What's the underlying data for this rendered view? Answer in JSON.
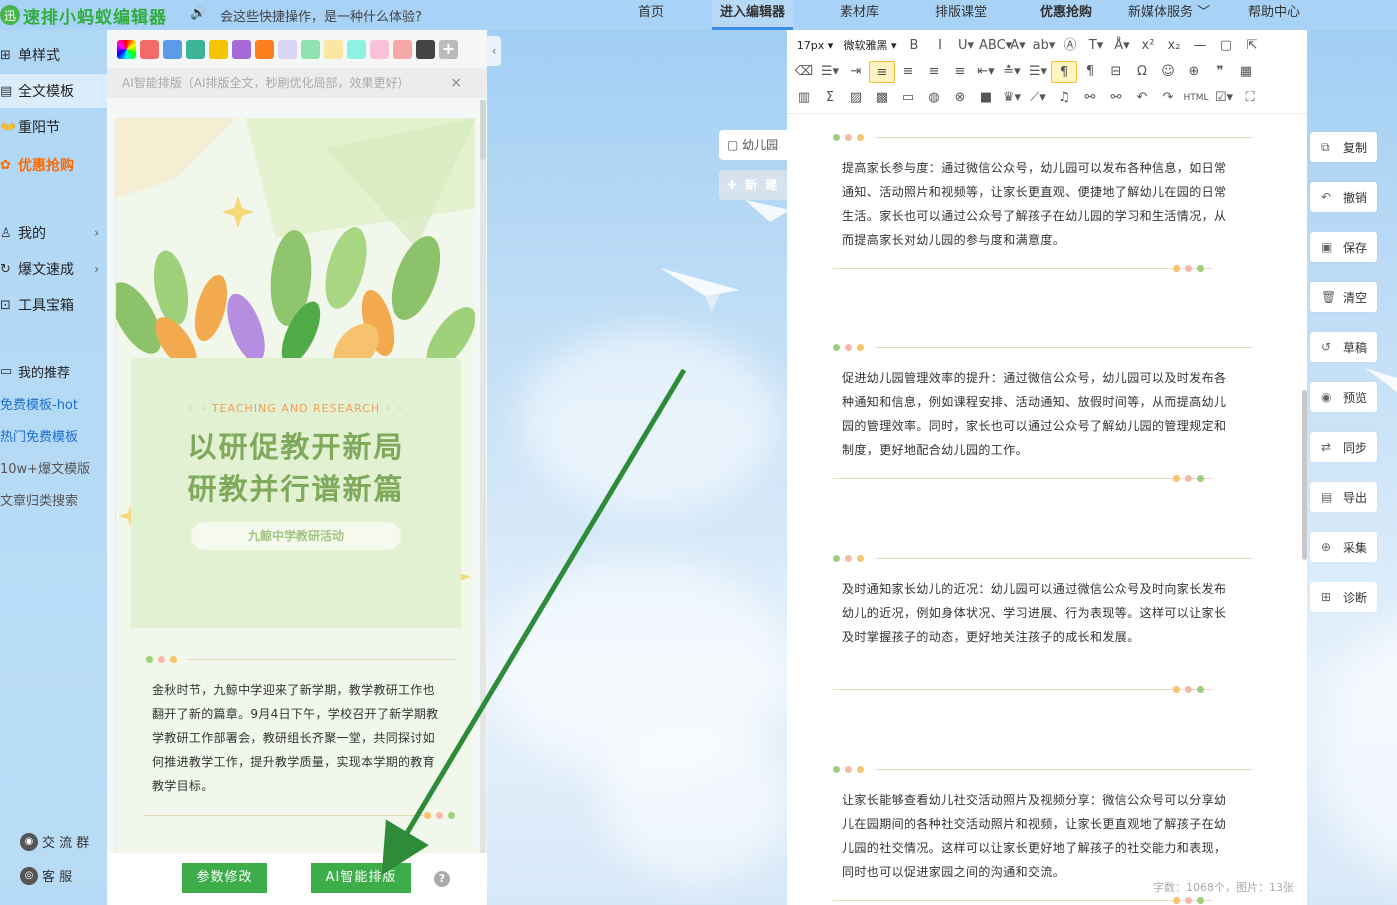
{
  "header": {
    "logo_mark": "迅",
    "logo": "速排小蚂蚁编辑器",
    "speaker_icon": "speaker-icon",
    "speaker_glyph": "🔊",
    "marquee": "会这些快捷操作，是一种什么体验?",
    "nav": [
      {
        "label": "首页"
      },
      {
        "label": "进入编辑器"
      },
      {
        "label": "素材库"
      },
      {
        "label": "排版课堂"
      },
      {
        "label": "优惠抢购"
      },
      {
        "label": "新媒体服务 ﹀"
      },
      {
        "label": "帮助中心"
      }
    ]
  },
  "sidebar": {
    "items": [
      {
        "label": "单样式",
        "icon": "grid-icon",
        "glyph": "⊞"
      },
      {
        "label": "全文模板",
        "icon": "document-icon",
        "glyph": "▤"
      },
      {
        "label": "重阳节",
        "icon": "hand-icon",
        "glyph": "👐"
      },
      {
        "label": "优惠抢购",
        "icon": "flame-icon",
        "glyph": "✿"
      }
    ],
    "menu": [
      {
        "label": "我的",
        "icon": "user-icon",
        "glyph": "♙",
        "chev": "›"
      },
      {
        "label": "爆文速成",
        "icon": "bolt-icon",
        "glyph": "↻",
        "chev": "›"
      },
      {
        "label": "工具宝箱",
        "icon": "toolbox-icon",
        "glyph": "⊡"
      }
    ],
    "recommend_title": "我的推荐",
    "recommend_icon_glyph": "▭",
    "links": [
      "免费模板-hot",
      "热门免费模板",
      "10w+爆文模版",
      "文章归类搜索"
    ],
    "footer": [
      {
        "label": "交 流 群",
        "icon": "chat-icon",
        "glyph": "◉"
      },
      {
        "label": "客  服",
        "icon": "headset-icon",
        "glyph": "◎"
      }
    ]
  },
  "panel": {
    "swatches": [
      "#f26b6b",
      "#5b9be8",
      "#3bb49a",
      "#f5c400",
      "#a56ad6",
      "#ff7f1e",
      "#d9d6f5",
      "#8fe3b0",
      "#fbe7a3",
      "#8ff0e3",
      "#f9c2d8",
      "#f6a7a7",
      "#444444"
    ],
    "plus_glyph": "+",
    "ai_hint": "AI智能排版（AI排版全文，秒刷优化局部，效果更好）",
    "close_glyph": "×",
    "collapse_glyph": "‹",
    "preview": {
      "tag": "TEACHING AND RESEARCH",
      "tag_deco": "◦ ◦",
      "title_line1": "以研促教开新局",
      "title_line2": "研教并行谱新篇",
      "subtitle": "九鲸中学教研活动",
      "body": "金秋时节，九鲸中学迎来了新学期，教学教研工作也翻开了新的篇章。9月4日下午，学校召开了新学期教学教研工作部署会，教研组长齐聚一堂，共同探讨如何推进教学工作，提升教学质量，实现本学期的教育教学目标。"
    },
    "buttons": {
      "params": "参数修改",
      "ai": "AI智能排版",
      "help": "?"
    }
  },
  "doc_tabs": {
    "current": "幼儿园",
    "current_icon_glyph": "▢",
    "new": "✚ 新 建"
  },
  "toolbar": {
    "font_size": "17px ▾",
    "font_family": "微软雅黑 ▾",
    "row1": [
      "B",
      "I",
      "U▾",
      "ABC▾",
      "A▾",
      "ab▾",
      "Ⓐ",
      "T▾",
      "Å▾",
      "x²",
      "x₂",
      "—",
      "▢",
      "⇱"
    ],
    "row2": [
      "⌫",
      "☰▾",
      "⇥",
      "≡",
      "≡",
      "≡",
      "≡",
      "⇤▾",
      "≛▾",
      "☰▾",
      "¶",
      "¶",
      "⊟",
      "Ω",
      "☺",
      "⊕",
      "❞",
      "▦"
    ],
    "row3": [
      "▥",
      "Σ",
      "▨",
      "▩",
      "▭",
      "◍",
      "⊗",
      "■",
      "♛▾",
      "⟋▾",
      "♫",
      "⚯",
      "⚯",
      "↶",
      "↷",
      "HTML",
      "☑▾",
      "⛶"
    ]
  },
  "content": {
    "blocks": [
      "提高家长参与度：通过微信公众号，幼儿园可以发布各种信息，如日常通知、活动照片和视频等，让家长更直观、便捷地了解幼儿在园的日常生活。家长也可以通过公众号了解孩子在幼儿园的学习和生活情况，从而提高家长对幼儿园的参与度和满意度。",
      "促进幼儿园管理效率的提升：通过微信公众号，幼儿园可以及时发布各种通知和信息，例如课程安排、活动通知、放假时间等，从而提高幼儿园的管理效率。同时，家长也可以通过公众号了解幼儿园的管理规定和制度，更好地配合幼儿园的工作。",
      "及时通知家长幼儿的近况：幼儿园可以通过微信公众号及时向家长发布幼儿的近况，例如身体状况、学习进展、行为表现等。这样可以让家长及时掌握孩子的动态，更好地关注孩子的成长和发展。",
      "让家长能够查看幼儿社交活动照片及视频分享：微信公众号可以分享幼儿在园期间的各种社交活动照片和视频，让家长更直观地了解孩子在幼儿园的社交情况。这样可以让家长更好地了解孩子的社交能力和表现，同时也可以促进家园之间的沟通和交流。"
    ],
    "counter": "字数：1068个，图片：13张"
  },
  "actions": [
    {
      "label": "复制",
      "icon": "copy-icon",
      "glyph": "⧉"
    },
    {
      "label": "撤销",
      "icon": "undo-icon",
      "glyph": "↶"
    },
    {
      "label": "保存",
      "icon": "save-icon",
      "glyph": "▣"
    },
    {
      "label": "清空",
      "icon": "trash-icon",
      "glyph": "🗑"
    },
    {
      "label": "草稿",
      "icon": "history-icon",
      "glyph": "↺"
    },
    {
      "label": "预览",
      "icon": "eye-icon",
      "glyph": "◉"
    },
    {
      "label": "同步",
      "icon": "sync-icon",
      "glyph": "⇄"
    },
    {
      "label": "导出",
      "icon": "export-icon",
      "glyph": "▤"
    },
    {
      "label": "采集",
      "icon": "zoom-icon",
      "glyph": "⊕"
    },
    {
      "label": "诊断",
      "icon": "plus-square-icon",
      "glyph": "⊞"
    }
  ],
  "colors": {
    "brand_green": "#3dad4a",
    "accent_blue": "#3d8ee8",
    "orange": "#ff6a00"
  }
}
